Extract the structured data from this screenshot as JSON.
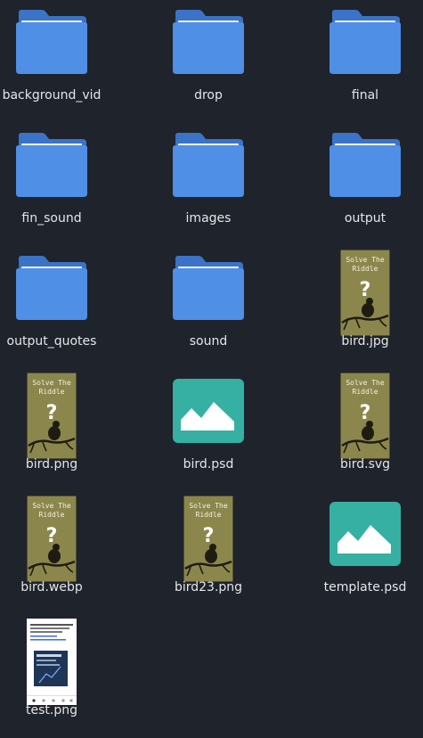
{
  "colors": {
    "background": "#1f232b",
    "folder_body": "#4f8fe6",
    "folder_back": "#3a73c8",
    "folder_paper": "#f1f3f5",
    "thumb_olive": "#8b864c",
    "psd_teal": "#35b0a2",
    "label_text": "#e4e6ea"
  },
  "items": [
    {
      "name": "background_vid",
      "kind": "folder",
      "icon": "folder-icon"
    },
    {
      "name": "drop",
      "kind": "folder",
      "icon": "folder-icon"
    },
    {
      "name": "final",
      "kind": "folder",
      "icon": "folder-icon"
    },
    {
      "name": "fin_sound",
      "kind": "folder",
      "icon": "folder-icon"
    },
    {
      "name": "images",
      "kind": "folder",
      "icon": "folder-icon"
    },
    {
      "name": "output",
      "kind": "folder",
      "icon": "folder-icon"
    },
    {
      "name": "output_quotes",
      "kind": "folder",
      "icon": "folder-icon"
    },
    {
      "name": "sound",
      "kind": "folder",
      "icon": "folder-icon"
    },
    {
      "name": "bird.jpg",
      "kind": "image",
      "icon": "image-thumbnail",
      "thumb_text": "Solve The Riddle"
    },
    {
      "name": "bird.png",
      "kind": "image",
      "icon": "image-thumbnail",
      "thumb_text": "Solve The Riddle"
    },
    {
      "name": "bird.psd",
      "kind": "psd",
      "icon": "picture-icon"
    },
    {
      "name": "bird.svg",
      "kind": "image",
      "icon": "image-thumbnail",
      "thumb_text": "Solve The Riddle"
    },
    {
      "name": "bird.webp",
      "kind": "image",
      "icon": "image-thumbnail",
      "thumb_text": "Solve The Riddle"
    },
    {
      "name": "bird23.png",
      "kind": "image",
      "icon": "image-thumbnail",
      "thumb_text": "Solve The Riddle"
    },
    {
      "name": "template.psd",
      "kind": "psd",
      "icon": "picture-icon"
    },
    {
      "name": "test.png",
      "kind": "screenshot",
      "icon": "screenshot-thumbnail"
    }
  ]
}
